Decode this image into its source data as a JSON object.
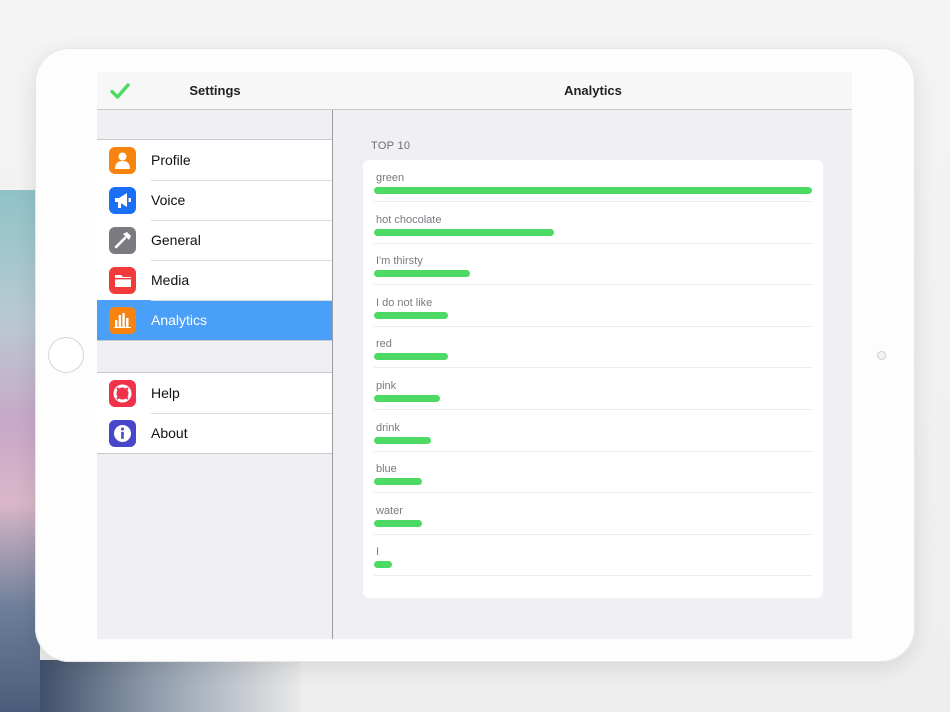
{
  "nav": {
    "left_title": "Settings",
    "right_title": "Analytics"
  },
  "sidebar": {
    "groups": [
      [
        {
          "label": "Profile",
          "icon": "person-icon",
          "color": "#f7840f"
        },
        {
          "label": "Voice",
          "icon": "megaphone-icon",
          "color": "#1b6ff5"
        },
        {
          "label": "General",
          "icon": "hammer-icon",
          "color": "#7a7a80"
        },
        {
          "label": "Media",
          "icon": "folder-icon",
          "color": "#f23a3a"
        },
        {
          "label": "Analytics",
          "icon": "bar-chart-icon",
          "color": "#f7840f",
          "selected": true
        }
      ],
      [
        {
          "label": "Help",
          "icon": "lifebuoy-icon",
          "color": "#f0324a"
        },
        {
          "label": "About",
          "icon": "info-icon",
          "color": "#4846c9"
        }
      ]
    ]
  },
  "colors": {
    "accent": "#4a9ff9",
    "bar": "#4cd964",
    "check": "#4cd964"
  },
  "chart_data": {
    "type": "bar",
    "title": "TOP 10",
    "categories": [
      "green",
      "hot chocolate",
      "I'm thirsty",
      "I do not like",
      "red",
      "pink",
      "drink",
      "blue",
      "water",
      "I"
    ],
    "values": [
      1.0,
      0.41,
      0.22,
      0.17,
      0.17,
      0.15,
      0.13,
      0.11,
      0.11,
      0.04
    ],
    "xlim": [
      0,
      1
    ]
  }
}
